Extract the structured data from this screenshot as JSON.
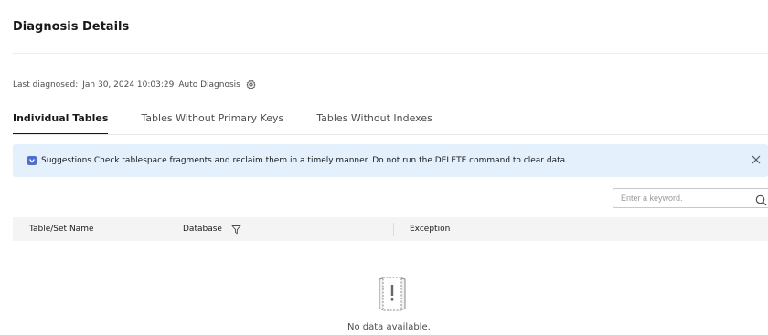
{
  "page": {
    "title": "Diagnosis Details"
  },
  "diagnosis": {
    "last_label": "Last diagnosed:",
    "last_value": "Jan 30, 2024 10:03:29",
    "auto_label": "Auto Diagnosis",
    "settings_icon": "gear-icon"
  },
  "tabs": [
    {
      "label": "Individual Tables",
      "active": true
    },
    {
      "label": "Tables Without Primary Keys",
      "active": false
    },
    {
      "label": "Tables Without Indexes",
      "active": false
    }
  ],
  "alert": {
    "text": "Suggestions Check tablespace fragments and reclaim them in a timely manner. Do not run the DELETE command to clear data.",
    "icon": "info-icon",
    "close_icon": "close-icon",
    "color": "#e5f0fd"
  },
  "search": {
    "placeholder": "Enter a keyword.",
    "value": "",
    "icon": "search-icon"
  },
  "table": {
    "columns": [
      {
        "label": "Table/Set Name"
      },
      {
        "label": "Database",
        "filter_icon": "filter-icon"
      },
      {
        "label": "Exception"
      }
    ],
    "rows": []
  },
  "empty": {
    "text": "No data available.",
    "icon": "empty-data-icon"
  }
}
